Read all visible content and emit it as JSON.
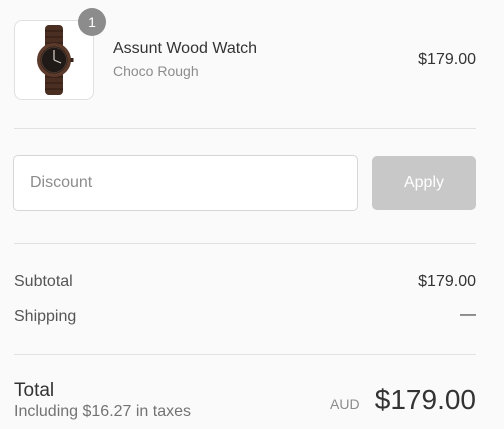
{
  "order": {
    "item": {
      "quantity": "1",
      "name": "Assunt Wood Watch",
      "variant": "Choco Rough",
      "price": "$179.00",
      "image_icon": "wood-watch-image"
    }
  },
  "discount": {
    "placeholder": "Discount",
    "value": "",
    "apply_label": "Apply"
  },
  "summary": {
    "subtotal_label": "Subtotal",
    "subtotal_value": "$179.00",
    "shipping_label": "Shipping",
    "shipping_value": "—"
  },
  "total": {
    "label": "Total",
    "taxes_note": "Including $16.27 in taxes",
    "currency": "AUD",
    "amount": "$179.00"
  },
  "colors": {
    "background": "#fafafa",
    "apply_button": "#c8c8c8",
    "badge": "#8c8c8c",
    "watch_wood": "#4a2e22"
  }
}
